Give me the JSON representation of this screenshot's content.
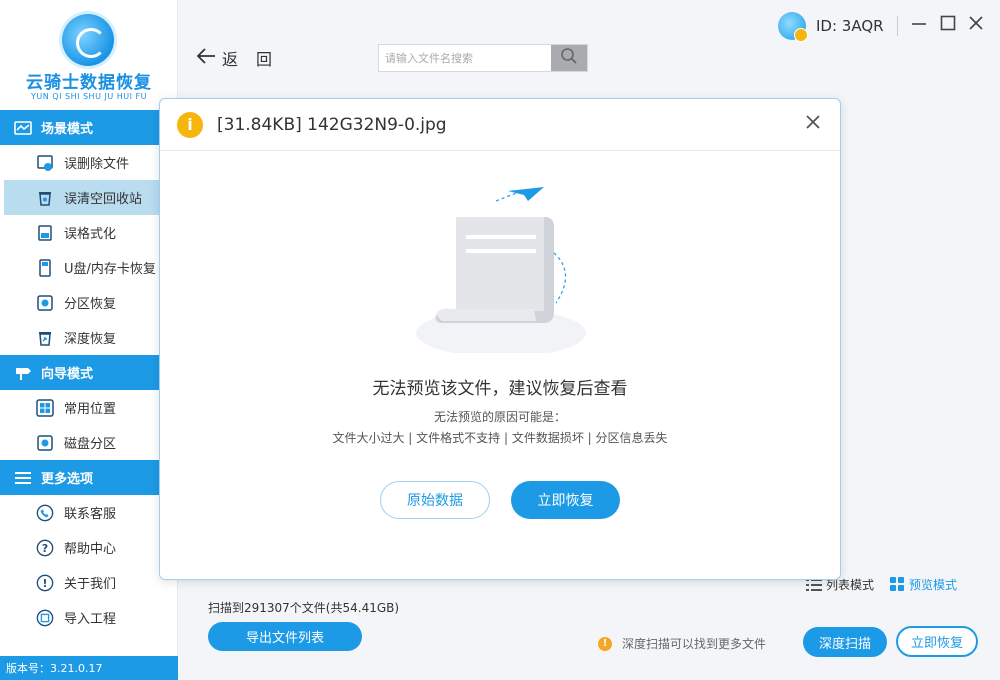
{
  "app": {
    "logo_title": "云骑士数据恢复",
    "logo_subtitle": "YUN QI SHI SHU JU HUI FU",
    "version": "版本号：3.21.0.17",
    "brand_color": "#1d9ae6"
  },
  "sidebar": {
    "sections": [
      {
        "title": "场景模式",
        "icon": "scene-mode-icon",
        "items": [
          {
            "label": "误删除文件",
            "icon": "deleted-file-icon"
          },
          {
            "label": "误清空回收站",
            "icon": "recycle-bin-icon",
            "active": true
          },
          {
            "label": "误格式化",
            "icon": "format-icon"
          },
          {
            "label": "U盘/内存卡恢复",
            "icon": "usb-icon"
          },
          {
            "label": "分区恢复",
            "icon": "partition-icon"
          },
          {
            "label": "深度恢复",
            "icon": "deep-recover-icon"
          }
        ]
      },
      {
        "title": "向导模式",
        "icon": "guide-mode-icon",
        "items": [
          {
            "label": "常用位置",
            "icon": "windows-icon"
          },
          {
            "label": "磁盘分区",
            "icon": "disk-icon"
          }
        ]
      },
      {
        "title": "更多选项",
        "icon": "menu-icon",
        "items": [
          {
            "label": "联系客服",
            "icon": "phone-icon"
          },
          {
            "label": "帮助中心",
            "icon": "help-icon"
          },
          {
            "label": "关于我们",
            "icon": "info-icon"
          },
          {
            "label": "导入工程",
            "icon": "import-icon"
          }
        ]
      }
    ]
  },
  "topbar": {
    "back_label": "返回",
    "search_placeholder": "请输入文件名搜索",
    "user_id": "ID: 3AQR"
  },
  "dialog": {
    "title": "[31.84KB] 142G32N9-0.jpg",
    "message": "无法预览该文件，建议恢复后查看",
    "reason_title": "无法预览的原因可能是：",
    "reasons": "文件大小过大 | 文件格式不支持 | 文件数据损坏 | 分区信息丢失",
    "raw_button": "原始数据",
    "recover_button": "立即恢复"
  },
  "bottom": {
    "list_mode": "列表模式",
    "preview_mode": "预览模式",
    "scan_info": "扫描到291307个文件(共54.41GB)",
    "export_button": "导出文件列表",
    "tip": "深度扫描可以找到更多文件",
    "deep_scan_button": "深度扫描",
    "recover_button": "立即恢复"
  }
}
